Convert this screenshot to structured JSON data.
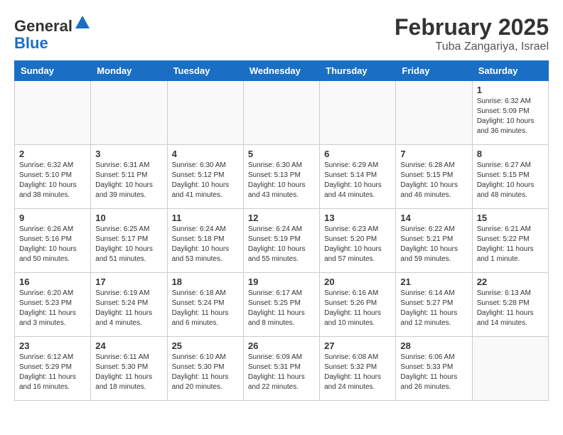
{
  "header": {
    "logo_general": "General",
    "logo_blue": "Blue",
    "title": "February 2025",
    "location": "Tuba Zangariya, Israel"
  },
  "weekdays": [
    "Sunday",
    "Monday",
    "Tuesday",
    "Wednesday",
    "Thursday",
    "Friday",
    "Saturday"
  ],
  "weeks": [
    [
      {
        "day": "",
        "info": ""
      },
      {
        "day": "",
        "info": ""
      },
      {
        "day": "",
        "info": ""
      },
      {
        "day": "",
        "info": ""
      },
      {
        "day": "",
        "info": ""
      },
      {
        "day": "",
        "info": ""
      },
      {
        "day": "1",
        "info": "Sunrise: 6:32 AM\nSunset: 5:09 PM\nDaylight: 10 hours and 36 minutes."
      }
    ],
    [
      {
        "day": "2",
        "info": "Sunrise: 6:32 AM\nSunset: 5:10 PM\nDaylight: 10 hours and 38 minutes."
      },
      {
        "day": "3",
        "info": "Sunrise: 6:31 AM\nSunset: 5:11 PM\nDaylight: 10 hours and 39 minutes."
      },
      {
        "day": "4",
        "info": "Sunrise: 6:30 AM\nSunset: 5:12 PM\nDaylight: 10 hours and 41 minutes."
      },
      {
        "day": "5",
        "info": "Sunrise: 6:30 AM\nSunset: 5:13 PM\nDaylight: 10 hours and 43 minutes."
      },
      {
        "day": "6",
        "info": "Sunrise: 6:29 AM\nSunset: 5:14 PM\nDaylight: 10 hours and 44 minutes."
      },
      {
        "day": "7",
        "info": "Sunrise: 6:28 AM\nSunset: 5:15 PM\nDaylight: 10 hours and 46 minutes."
      },
      {
        "day": "8",
        "info": "Sunrise: 6:27 AM\nSunset: 5:15 PM\nDaylight: 10 hours and 48 minutes."
      }
    ],
    [
      {
        "day": "9",
        "info": "Sunrise: 6:26 AM\nSunset: 5:16 PM\nDaylight: 10 hours and 50 minutes."
      },
      {
        "day": "10",
        "info": "Sunrise: 6:25 AM\nSunset: 5:17 PM\nDaylight: 10 hours and 51 minutes."
      },
      {
        "day": "11",
        "info": "Sunrise: 6:24 AM\nSunset: 5:18 PM\nDaylight: 10 hours and 53 minutes."
      },
      {
        "day": "12",
        "info": "Sunrise: 6:24 AM\nSunset: 5:19 PM\nDaylight: 10 hours and 55 minutes."
      },
      {
        "day": "13",
        "info": "Sunrise: 6:23 AM\nSunset: 5:20 PM\nDaylight: 10 hours and 57 minutes."
      },
      {
        "day": "14",
        "info": "Sunrise: 6:22 AM\nSunset: 5:21 PM\nDaylight: 10 hours and 59 minutes."
      },
      {
        "day": "15",
        "info": "Sunrise: 6:21 AM\nSunset: 5:22 PM\nDaylight: 11 hours and 1 minute."
      }
    ],
    [
      {
        "day": "16",
        "info": "Sunrise: 6:20 AM\nSunset: 5:23 PM\nDaylight: 11 hours and 3 minutes."
      },
      {
        "day": "17",
        "info": "Sunrise: 6:19 AM\nSunset: 5:24 PM\nDaylight: 11 hours and 4 minutes."
      },
      {
        "day": "18",
        "info": "Sunrise: 6:18 AM\nSunset: 5:24 PM\nDaylight: 11 hours and 6 minutes."
      },
      {
        "day": "19",
        "info": "Sunrise: 6:17 AM\nSunset: 5:25 PM\nDaylight: 11 hours and 8 minutes."
      },
      {
        "day": "20",
        "info": "Sunrise: 6:16 AM\nSunset: 5:26 PM\nDaylight: 11 hours and 10 minutes."
      },
      {
        "day": "21",
        "info": "Sunrise: 6:14 AM\nSunset: 5:27 PM\nDaylight: 11 hours and 12 minutes."
      },
      {
        "day": "22",
        "info": "Sunrise: 6:13 AM\nSunset: 5:28 PM\nDaylight: 11 hours and 14 minutes."
      }
    ],
    [
      {
        "day": "23",
        "info": "Sunrise: 6:12 AM\nSunset: 5:29 PM\nDaylight: 11 hours and 16 minutes."
      },
      {
        "day": "24",
        "info": "Sunrise: 6:11 AM\nSunset: 5:30 PM\nDaylight: 11 hours and 18 minutes."
      },
      {
        "day": "25",
        "info": "Sunrise: 6:10 AM\nSunset: 5:30 PM\nDaylight: 11 hours and 20 minutes."
      },
      {
        "day": "26",
        "info": "Sunrise: 6:09 AM\nSunset: 5:31 PM\nDaylight: 11 hours and 22 minutes."
      },
      {
        "day": "27",
        "info": "Sunrise: 6:08 AM\nSunset: 5:32 PM\nDaylight: 11 hours and 24 minutes."
      },
      {
        "day": "28",
        "info": "Sunrise: 6:06 AM\nSunset: 5:33 PM\nDaylight: 11 hours and 26 minutes."
      },
      {
        "day": "",
        "info": ""
      }
    ]
  ]
}
